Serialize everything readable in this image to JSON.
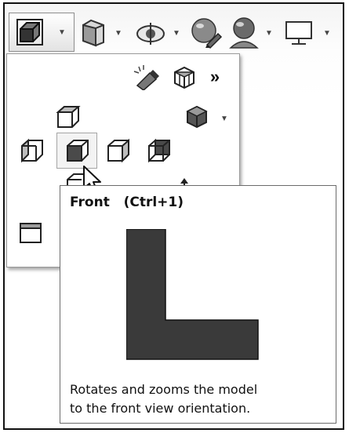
{
  "toolbar": {
    "items": [
      {
        "icon": "view-orientation-icon",
        "has_dropdown": true,
        "active": true
      },
      {
        "icon": "display-style-icon",
        "has_dropdown": true
      },
      {
        "icon": "hide-show-items-icon",
        "has_dropdown": true
      },
      {
        "icon": "edit-appearance-icon",
        "has_dropdown": false
      },
      {
        "icon": "apply-scene-icon",
        "has_dropdown": true
      },
      {
        "icon": "view-settings-icon",
        "has_dropdown": true
      }
    ]
  },
  "view_panel": {
    "top_icons": [
      "pin-flashlight-icon",
      "view-selector-icon",
      "more-chevron-icon"
    ],
    "more_label": "»",
    "views": [
      "top-view",
      "dimetric-view-dropdown",
      "left-view",
      "front-view",
      "right-view",
      "back-view",
      "bottom-view",
      "up-arrow",
      "single-view"
    ]
  },
  "tooltip": {
    "title": "Front   (Ctrl+1)",
    "description_lines": [
      "Rotates and zooms the model",
      "to the front view orientation."
    ],
    "preview_color": "#3a3a3a"
  }
}
